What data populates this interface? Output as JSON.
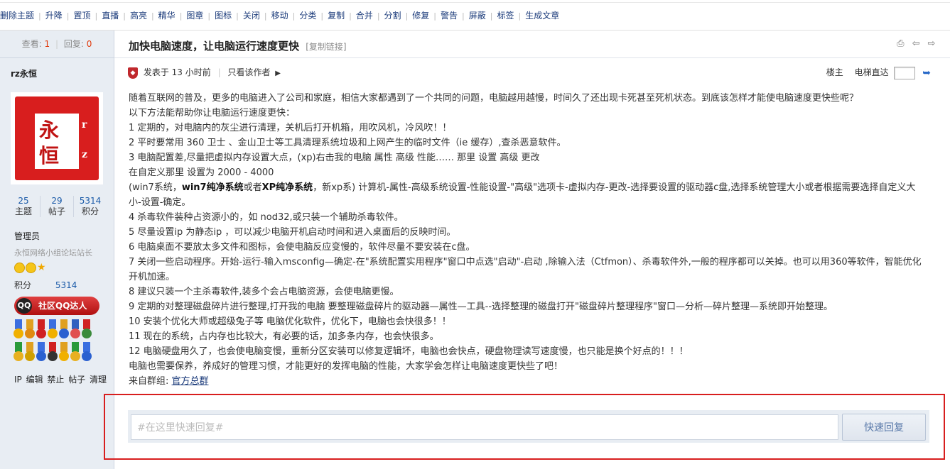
{
  "toolbar": {
    "items": [
      "删除主题",
      "升降",
      "置顶",
      "直播",
      "高亮",
      "精华",
      "图章",
      "图标",
      "关闭",
      "移动",
      "分类",
      "复制",
      "合并",
      "分割",
      "修复",
      "警告",
      "屏蔽",
      "标签",
      "生成文章"
    ]
  },
  "side_stats": {
    "views_label": "查看:",
    "views": "1",
    "replies_label": "回复:",
    "replies": "0"
  },
  "post": {
    "title": "加快电脑速度，让电脑运行速度更快",
    "copy_link": "[复制链接]",
    "posted_at": "发表于 13 小时前",
    "only_author": "只看该作者",
    "floor": "楼主",
    "floor_jump": "电梯直达"
  },
  "author": {
    "name": "rz永恒",
    "avatar_chars": [
      "永",
      "恒",
      "r",
      "z"
    ],
    "stats": [
      {
        "value": "25",
        "label": "主题"
      },
      {
        "value": "29",
        "label": "帖子"
      },
      {
        "value": "5314",
        "label": "积分"
      }
    ],
    "role": "管理员",
    "rank": "永恒网络小组论坛站长",
    "points_label": "积分",
    "points": "5314",
    "qq_badge": "社区QQ达人",
    "actions": "IP 编辑 禁止 帖子 清理"
  },
  "content": {
    "paragraphs": [
      "随着互联网的普及，更多的电脑进入了公司和家庭，相信大家都遇到了一个共同的问题，电脑越用越慢，时间久了还出现卡死甚至死机状态。到底该怎样才能使电脑速度更快些呢？",
      "以下方法能帮助你让电脑运行速度更快：",
      "1 定期的，对电脑内的灰尘进行清理，关机后打开机箱，用吹风机，冷风吹！！",
      "2 平时要常用 360 卫士 、金山卫士等工具清理系统垃圾和上网产生的临时文件（ie 缓存）,查杀恶意软件。",
      "3 电脑配置差,尽量把虚拟内存设置大点，(xp)右击我的电脑 属性 高级 性能…… 那里 设置 高级 更改",
      "在自定义那里 设置为 2000 - 4000"
    ],
    "win7_prefix": "(win7系统，",
    "win7_bold": "win7纯净系统",
    "win7_mid": "或者",
    "xp_bold": "XP纯净系统",
    "win7_rest": "，新xp系) 计算机-属性-高级系统设置-性能设置-\"高级\"选项卡-虚拟内存-更改-选择要设置的驱动器c盘,选择系统管理大小或者根据需要选择自定义大小-设置-确定。",
    "paragraphs2": [
      "4 杀毒软件装种占资源小的，如 nod32,或只装一个辅助杀毒软件。",
      "5 尽量设置ip 为静态ip ，可以减少电脑开机启动时间和进入桌面后的反映时间。",
      "6 电脑桌面不要放太多文件和图标，会使电脑反应变慢的，软件尽量不要安装在c盘。",
      "7 关闭一些启动程序。开始-运行-输入msconfig—确定-在\"系统配置实用程序\"窗口中点选\"启动\"-启动 ,除输入法（Ctfmon）、杀毒软件外,一般的程序都可以关掉。也可以用360等软件，智能优化开机加速。",
      "8 建议只装一个主杀毒软件,装多个会占电脑资源，会使电脑更慢。",
      "9 定期的对整理磁盘碎片进行整理,打开我的电脑 要整理磁盘碎片的驱动器—属性—工具--选择整理的磁盘打开\"磁盘碎片整理程序\"窗口—分析—碎片整理—系统即开始整理。",
      "10 安装个优化大师或超级兔子等 电脑优化软件，优化下，电脑也会快很多！！",
      "11 现在的系统，占内存也比较大，有必要的话，加多条内存，也会快很多。",
      "12 电脑硬盘用久了，也会使电脑变慢，重新分区安装可以修复逻辑坏，电脑也会快点，硬盘物理读写速度慢，也只能是换个好点的！！！",
      "电脑也需要保养，养成好的管理习惯，才能更好的发挥电脑的性能，大家学会怎样让电脑速度更快些了吧！"
    ],
    "source_label": "来自群组: ",
    "source_link": "官方总群"
  },
  "reply": {
    "placeholder": "#在这里快速回复#",
    "button": "快速回复"
  },
  "colors": {
    "accent": "#1a5aa8",
    "highlight_frame": "#d81e1e",
    "sidebar_bg": "#e8edf3"
  }
}
